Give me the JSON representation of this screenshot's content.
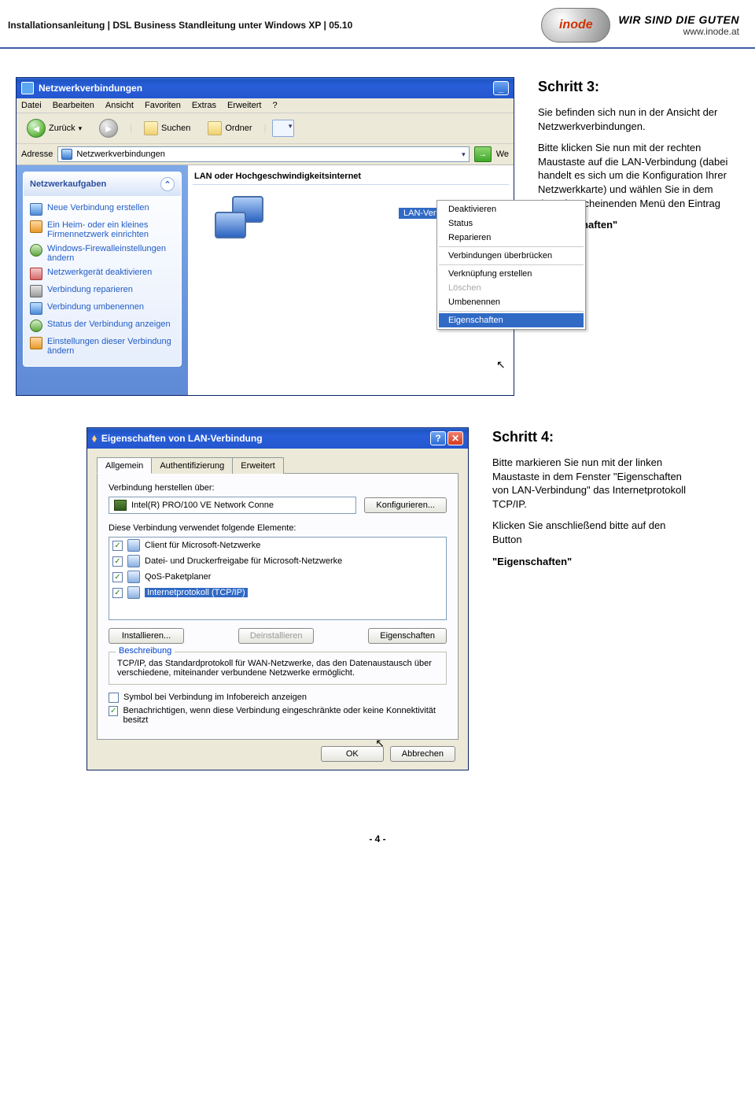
{
  "header": {
    "left": "Installationsanleitung  |  DSL Business Standleitung unter Windows XP  |  05.10",
    "brand_tag": "WIR SIND DIE GUTEN",
    "brand_url": "www.inode.at",
    "logo_text": "inode"
  },
  "step3": {
    "title": "Schritt 3:",
    "p1": "Sie befinden sich nun in der Ansicht der Netzwerk­verbindungen.",
    "p2": "Bitte klicken Sie nun mit der rechten Maustaste auf die LAN-Verbindung (dabei handelt es sich um die Konfiguration Ihrer Netzwerkkarte) und wählen Sie in dem darauf erscheinenden Menü den Eintrag",
    "quoted": "\"Eigenschaften\"",
    "win": {
      "title": "Netzwerkverbindungen",
      "menu": [
        "Datei",
        "Bearbeiten",
        "Ansicht",
        "Favoriten",
        "Extras",
        "Erweitert",
        "?"
      ],
      "back": "Zurück",
      "search": "Suchen",
      "folders": "Ordner",
      "addr_label": "Adresse",
      "addr_value": "Netzwerkverbindungen",
      "go": "We",
      "panel_title": "Netzwerkaufgaben",
      "tasks": [
        "Neue Verbindung erstellen",
        "Ein Heim- oder ein kleines Firmennetzwerk einrichten",
        "Windows-Firewalleinstellungen ändern",
        "Netzwerkgerät deaktivieren",
        "Verbindung reparieren",
        "Verbindung umbenennen",
        "Status der Verbindung anzeigen",
        "Einstellungen dieser Verbindung ändern"
      ],
      "group": "LAN oder Hochgeschwindigkeitsinternet",
      "conn_label": "LAN-Verbind",
      "ctx": {
        "items": [
          {
            "label": "Deaktivieren",
            "disabled": false
          },
          {
            "label": "Status",
            "disabled": false
          },
          {
            "label": "Reparieren",
            "disabled": false
          },
          {
            "sep": true
          },
          {
            "label": "Verbindungen überbrücken",
            "disabled": false
          },
          {
            "sep": true
          },
          {
            "label": "Verknüpfung erstellen",
            "disabled": false
          },
          {
            "label": "Löschen",
            "disabled": true
          },
          {
            "label": "Umbenennen",
            "disabled": false
          },
          {
            "sep": true
          },
          {
            "label": "Eigenschaften",
            "selected": true
          }
        ]
      }
    }
  },
  "step4": {
    "title": "Schritt 4:",
    "p1": "Bitte markieren Sie nun mit der linken Maustaste in dem Fenster \"Eigenschaften von LAN-Verbindung\" das Internetprotokoll TCP/IP.",
    "p2": "Klicken Sie anschließend bitte auf den Button",
    "quoted": "\"Eigenschaften\"",
    "dlg": {
      "title": "Eigenschaften von LAN-Verbindung",
      "tabs": [
        "Allgemein",
        "Authentifizierung",
        "Erweitert"
      ],
      "conn_via": "Verbindung herstellen über:",
      "adapter": "Intel(R) PRO/100 VE Network Conne",
      "configure": "Konfigurieren...",
      "uses": "Diese Verbindung verwendet folgende Elemente:",
      "elements": [
        "Client für Microsoft-Netzwerke",
        "Datei- und Druckerfreigabe für Microsoft-Netzwerke",
        "QoS-Paketplaner",
        "Internetprotokoll (TCP/IP)"
      ],
      "install": "Installieren...",
      "uninstall": "Deinstallieren",
      "props": "Eigenschaften",
      "desc_legend": "Beschreibung",
      "desc_text": "TCP/IP, das Standardprotokoll für WAN-Netzwerke, das den Datenaustausch über verschiedene, miteinander verbundene Netzwerke ermöglicht.",
      "chk1": "Symbol bei Verbindung im Infobereich anzeigen",
      "chk2": "Benachrichtigen, wenn diese Verbindung eingeschränkte oder keine Konnektivität besitzt",
      "ok": "OK",
      "cancel": "Abbrechen"
    }
  },
  "footer": "- 4 -"
}
